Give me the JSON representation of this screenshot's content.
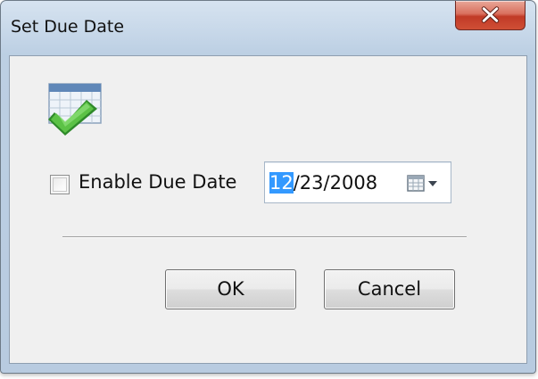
{
  "window": {
    "title": "Set Due Date"
  },
  "icons": {
    "app_icon": "calendar-checkmark-icon",
    "close_icon": "close-icon",
    "calendar_dropdown": "calendar-dropdown-icon"
  },
  "due_date": {
    "enable_label": "Enable Due Date",
    "checked": false,
    "date_month": "12",
    "date_rest": "/23/2008"
  },
  "buttons": {
    "ok_label": "OK",
    "cancel_label": "Cancel"
  },
  "colors": {
    "selection": "#3399ff",
    "close_button": "#c13a26",
    "checkmark": "#4caf3a"
  }
}
